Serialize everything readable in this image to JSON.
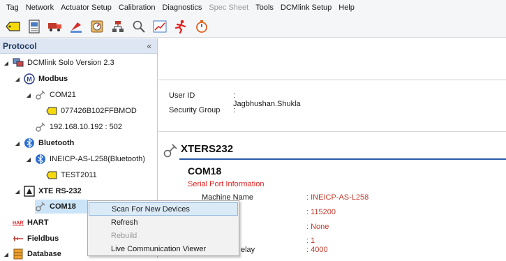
{
  "menu": {
    "items": [
      "Tag",
      "Network",
      "Actuator Setup",
      "Calibration",
      "Diagnostics",
      "Spec Sheet",
      "Tools",
      "DCMlink Setup",
      "Help"
    ],
    "disabled": [
      "Spec Sheet"
    ]
  },
  "toolbar": {
    "icons": [
      "tag-icon",
      "document-icon",
      "truck-icon",
      "flag-icon",
      "gauge-icon",
      "network-icon",
      "search-icon",
      "chart-icon",
      "runner-icon",
      "timer-icon"
    ]
  },
  "left_panel": {
    "title": "Protocol",
    "collapse_glyph": "«"
  },
  "tree": [
    {
      "label": "DCMlink Solo Version 2.3",
      "icon": "computer-icon"
    },
    {
      "label": "Modbus",
      "icon": "modbus-icon"
    },
    {
      "label": "COM21",
      "icon": "port-icon"
    },
    {
      "label": "077426B102FFBMOD",
      "icon": "tag-icon"
    },
    {
      "label": "192.168.10.192 : 502",
      "icon": "port-icon"
    },
    {
      "label": "Bluetooth",
      "icon": "bluetooth-icon"
    },
    {
      "label": "INEICP-AS-L258(Bluetooth)",
      "icon": "bluetooth-icon"
    },
    {
      "label": "TEST2011",
      "icon": "tag-icon"
    },
    {
      "label": "XTE RS-232",
      "icon": "rs232-icon"
    },
    {
      "label": "COM18",
      "icon": "port-icon"
    },
    {
      "label": "HART",
      "icon": "hart-icon"
    },
    {
      "label": "Fieldbus",
      "icon": "fieldbus-icon"
    },
    {
      "label": "Database",
      "icon": "database-icon"
    }
  ],
  "user": {
    "user_id_label": "User ID",
    "user_id_value": ": Jagbhushan.Shukla",
    "security_group_label": "Security Group",
    "security_group_value": ":"
  },
  "device": {
    "title": "XTERS232",
    "port": "COM18",
    "subtitle": "Serial Port Information",
    "properties": [
      {
        "label": "Machine Name",
        "value": ": INEICP-AS-L258"
      },
      {
        "label": "",
        "value": ": 115200"
      },
      {
        "label": "",
        "value": ": None"
      },
      {
        "label": "",
        "value": ": 1"
      },
      {
        "label": "elay",
        "value": ": 4000"
      }
    ]
  },
  "context_menu": {
    "items": [
      "Scan For New Devices",
      "Refresh",
      "Rebuild",
      "Live Communication Viewer"
    ]
  },
  "colors": {
    "accent": "#2a5aa8",
    "value_red": "#c0392b",
    "highlight": "#dbeaf7"
  }
}
